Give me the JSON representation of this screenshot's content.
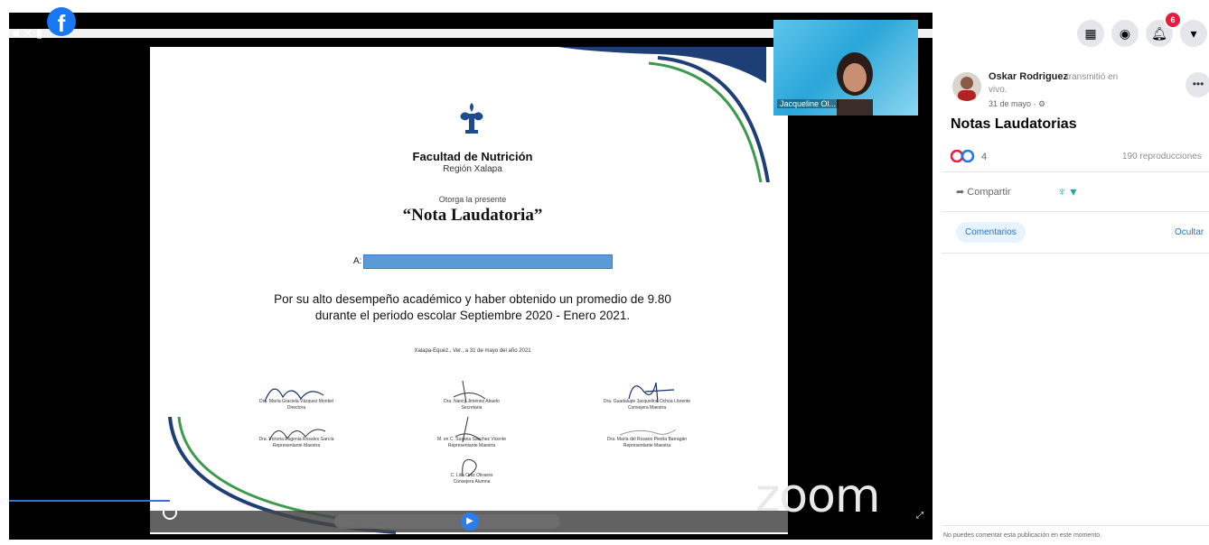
{
  "video": {
    "topbar_controls": "■ ✕ ▮",
    "facebook_logo": "f",
    "participant_name": "Jacqueline Ol...",
    "zoom_watermark": "zoom",
    "time_label": "",
    "icons": {
      "facebook": "facebook-logo-icon",
      "play": "play-icon",
      "fullscreen": "fullscreen-icon"
    }
  },
  "certificate": {
    "faculty": "Facultad de Nutrición",
    "region": "Región Xalapa",
    "otorga": "Otorga la presente",
    "title": "“Nota Laudatoria”",
    "recipient_prefix": "A:",
    "reason_line1": "Por su alto desempeño académico y haber obtenido un promedio de 9.80",
    "reason_line2": "durante el periodo escolar Septiembre 2020 -  Enero 2021.",
    "place_date": "Xalapa-Equez., Ver., a 31 de mayo del año 2021",
    "signatures": [
      {
        "name": "Dra. María Graciela Vázquez Montiel",
        "role": "Directora"
      },
      {
        "name": "Dra. Nancy Jiménez Abuelo",
        "role": "Secretaria"
      },
      {
        "name": "Dra. Guadalupe Jacqueline Ochoa Llorente",
        "role": "Consejera Maestra"
      },
      {
        "name": "Dra. Victoria Eugenia Rosales García",
        "role": "Representante Maestra"
      },
      {
        "name": "M. en C. Susana Sánchez Vicente",
        "role": "Representante Maestra"
      },
      {
        "name": "Dra. María del Rosario Piedra Barragán",
        "role": "Representante Maestra"
      },
      {
        "name": "C. Lilia Ortiz Olivares",
        "role": "Consejera Alumna"
      }
    ]
  },
  "sidebar": {
    "notification_count": "6",
    "author": "Oskar Rodriguez",
    "action_part1": "transmitió en",
    "action_part2": "vivo.",
    "date": "31 de mayo · ⚙",
    "post_title": "Notas Laudatorias",
    "reaction_count": "4",
    "views": "190 reproducciones",
    "share_label": "Compartir",
    "comments_tab": "Comentarios",
    "hide_label": "Ocultar",
    "footer_note": "No puedes comentar esta publicación en este momento.",
    "icons": {
      "menu": "grid-menu-icon",
      "messenger": "messenger-icon",
      "notifications": "bell-icon",
      "account": "chevron-down-icon",
      "more": "more-options-icon",
      "share": "share-icon",
      "reaction": "uv-logo-reaction-icon"
    },
    "colors": {
      "accent": "#1b74e4",
      "badge": "#e41e3f",
      "reaction_love": "#e41e3f",
      "reaction_like": "#1877f2"
    }
  }
}
